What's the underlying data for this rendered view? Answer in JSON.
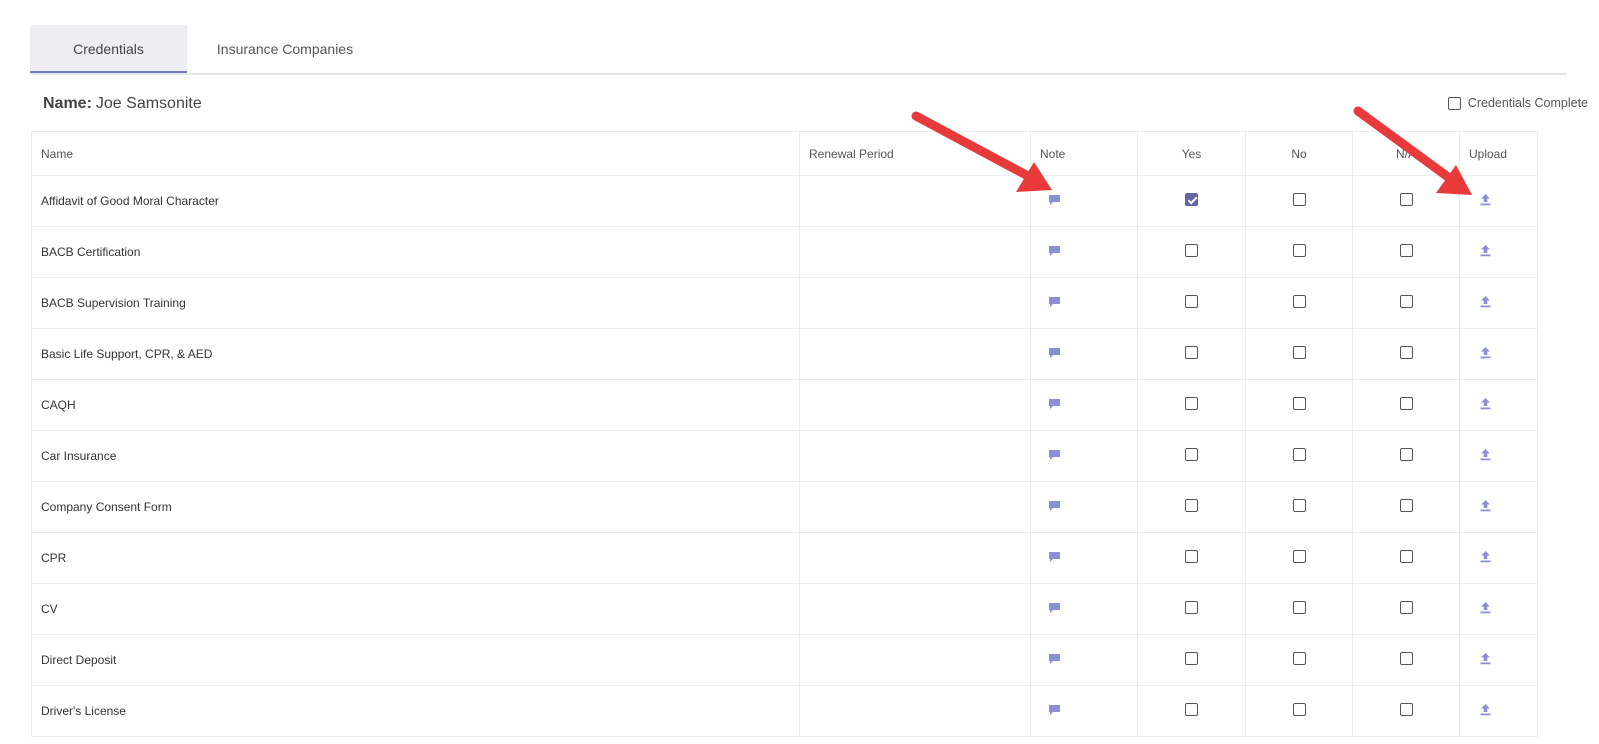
{
  "tabs": [
    {
      "label": "Credentials",
      "active": true
    },
    {
      "label": "Insurance Companies",
      "active": false
    }
  ],
  "header": {
    "name_label": "Name:",
    "name_value": "Joe Samsonite",
    "complete_label": "Credentials Complete",
    "complete_checked": false
  },
  "columns": {
    "name": "Name",
    "renewal": "Renewal Period",
    "note": "Note",
    "yes": "Yes",
    "no": "No",
    "na": "N/A",
    "upload": "Upload"
  },
  "rows": [
    {
      "name": "Affidavit of Good Moral Character",
      "renewal": "",
      "yes": true,
      "no": false,
      "na": false
    },
    {
      "name": "BACB Certification",
      "renewal": "",
      "yes": false,
      "no": false,
      "na": false
    },
    {
      "name": "BACB Supervision Training",
      "renewal": "",
      "yes": false,
      "no": false,
      "na": false
    },
    {
      "name": "Basic Life Support, CPR, & AED",
      "renewal": "",
      "yes": false,
      "no": false,
      "na": false
    },
    {
      "name": "CAQH",
      "renewal": "",
      "yes": false,
      "no": false,
      "na": false
    },
    {
      "name": "Car Insurance",
      "renewal": "",
      "yes": false,
      "no": false,
      "na": false
    },
    {
      "name": "Company Consent Form",
      "renewal": "",
      "yes": false,
      "no": false,
      "na": false
    },
    {
      "name": "CPR",
      "renewal": "",
      "yes": false,
      "no": false,
      "na": false
    },
    {
      "name": "CV",
      "renewal": "",
      "yes": false,
      "no": false,
      "na": false
    },
    {
      "name": "Direct Deposit",
      "renewal": "",
      "yes": false,
      "no": false,
      "na": false
    },
    {
      "name": "Driver's License",
      "renewal": "",
      "yes": false,
      "no": false,
      "na": false
    }
  ],
  "icons": {
    "note": "comment-icon",
    "upload": "upload-icon"
  },
  "colors": {
    "accent": "#6165a8",
    "icon": "#8b90d6",
    "arrow": "#e8393b"
  }
}
